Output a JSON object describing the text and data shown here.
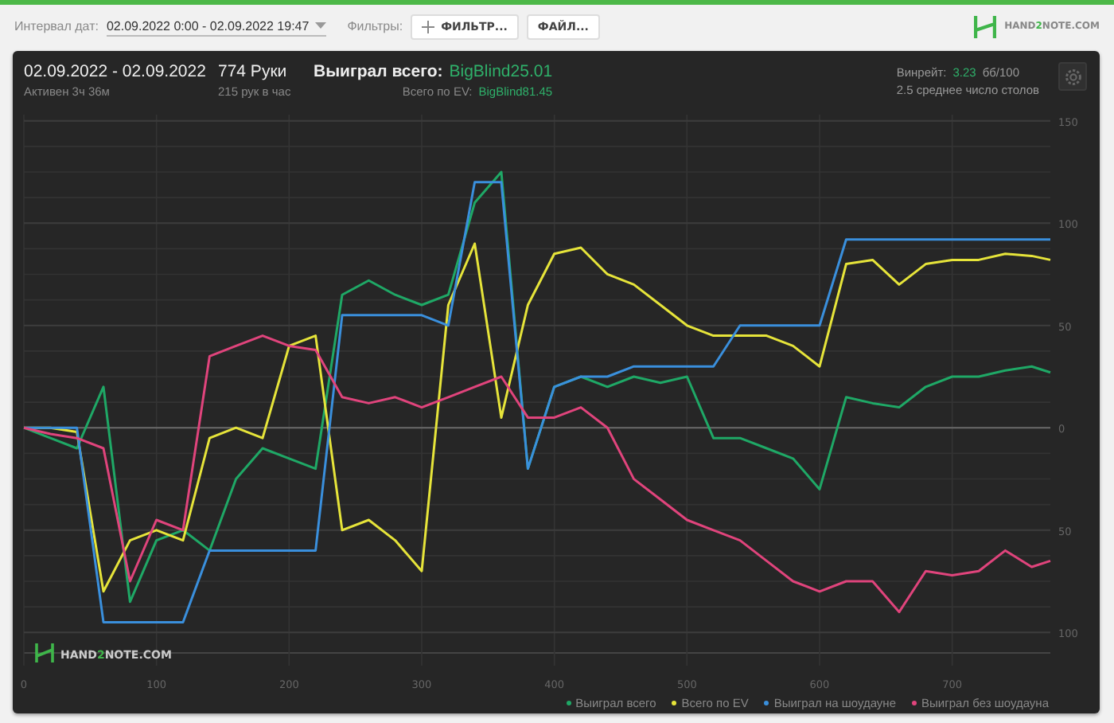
{
  "toolbar": {
    "interval_label": "Интервал дат:",
    "interval_value": "02.09.2022 0:00 - 02.09.2022 19:47",
    "filters_label": "Фильтры:",
    "buttons": [
      {
        "kind": "add",
        "label": "ФИЛЬТР..."
      },
      {
        "kind": "plain",
        "label": "ФАЙЛ..."
      }
    ],
    "logo": {
      "prefix": "HAND",
      "accent": "2",
      "suffix": "NOTE.COM"
    }
  },
  "stats": {
    "dates": "02.09.2022 - 02.09.2022",
    "active": "Активен 3ч 36м",
    "hands": "774 Руки",
    "hands_rate": "215 рук в час",
    "won_label": "Выиграл всего:",
    "won_value": "BigBlind25.01",
    "ev_label": "Всего по EV:",
    "ev_value": "BigBlind81.45",
    "winrate_label": "Винрейт:",
    "winrate_value": "3.23",
    "winrate_unit": "бб/100",
    "tables": "2.5 среднее число столов"
  },
  "chart": {
    "watermark": {
      "prefix": "HAND",
      "accent": "2",
      "suffix": "NOTE.COM"
    },
    "chart_data": {
      "type": "line",
      "x": [
        0,
        20,
        40,
        60,
        80,
        100,
        120,
        140,
        160,
        180,
        200,
        220,
        240,
        260,
        280,
        300,
        320,
        340,
        360,
        380,
        400,
        420,
        440,
        460,
        480,
        500,
        520,
        540,
        560,
        580,
        600,
        620,
        640,
        660,
        680,
        700,
        720,
        740,
        760,
        774
      ],
      "grid": true,
      "xlim": [
        0,
        774
      ],
      "ylim": [
        -110,
        153
      ],
      "xticks": [
        0,
        100,
        200,
        300,
        400,
        500,
        600,
        700
      ],
      "yticks": [
        {
          "value": 150,
          "label": "150"
        },
        {
          "value": 100,
          "label": "100"
        },
        {
          "value": 50,
          "label": "50"
        },
        {
          "value": 0,
          "label": "0"
        },
        {
          "value": -50,
          "label": "50"
        },
        {
          "value": -100,
          "label": "100"
        }
      ],
      "series": [
        {
          "name": "Выиграл всего",
          "color": "#1fa866",
          "values": [
            0,
            -5,
            -10,
            20,
            -85,
            -55,
            -50,
            -60,
            -25,
            -10,
            -15,
            -20,
            65,
            72,
            65,
            60,
            65,
            110,
            125,
            -20,
            20,
            25,
            20,
            25,
            22,
            25,
            -5,
            -5,
            -10,
            -15,
            -30,
            15,
            12,
            10,
            20,
            25,
            25,
            28,
            30,
            27
          ]
        },
        {
          "name": "Всего по EV",
          "color": "#e6e43a",
          "values": [
            0,
            0,
            -2,
            -80,
            -55,
            -50,
            -55,
            -5,
            0,
            -5,
            40,
            45,
            -50,
            -45,
            -55,
            -70,
            60,
            90,
            5,
            60,
            85,
            88,
            75,
            70,
            60,
            50,
            45,
            45,
            45,
            40,
            30,
            80,
            82,
            70,
            80,
            82,
            82,
            85,
            84,
            82
          ]
        },
        {
          "name": "Выиграл на шоудауне",
          "color": "#3a8fdc",
          "values": [
            0,
            0,
            0,
            -95,
            -95,
            -95,
            -95,
            -60,
            -60,
            -60,
            -60,
            -60,
            55,
            55,
            55,
            55,
            50,
            120,
            120,
            -20,
            20,
            25,
            25,
            30,
            30,
            30,
            30,
            50,
            50,
            50,
            50,
            92,
            92,
            92,
            92,
            92,
            92,
            92,
            92,
            92
          ]
        },
        {
          "name": "Выиграл без шоудауна",
          "color": "#e0447c",
          "values": [
            0,
            -3,
            -5,
            -10,
            -75,
            -45,
            -50,
            35,
            40,
            45,
            40,
            38,
            15,
            12,
            15,
            10,
            15,
            20,
            25,
            5,
            5,
            10,
            0,
            -25,
            -35,
            -45,
            -50,
            -55,
            -65,
            -75,
            -80,
            -75,
            -75,
            -90,
            -70,
            -72,
            -70,
            -60,
            -68,
            -65
          ]
        }
      ]
    }
  }
}
